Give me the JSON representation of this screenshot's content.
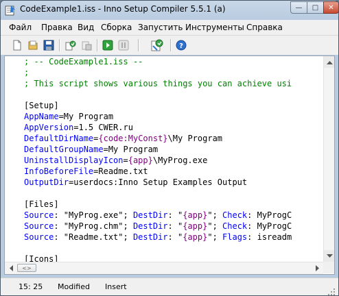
{
  "window": {
    "title": "CodeExample1.iss - Inno Setup Compiler 5.5.1 (a)",
    "controls": {
      "minimize": "—",
      "maximize": "□",
      "close": "✕"
    }
  },
  "menu": [
    "Файл",
    "Правка",
    "Вид",
    "Сборка",
    "Запустить",
    "Инструменты",
    "Справка"
  ],
  "toolbar": {
    "buttons": [
      "new-icon",
      "open-icon",
      "save-icon",
      "compile-icon",
      "stop-compile-icon",
      "run-icon",
      "pause-icon",
      "wizard-icon",
      "help-icon"
    ]
  },
  "editor": {
    "lines": [
      [
        {
          "t": "; -- CodeExample1.iss --",
          "c": "comment"
        }
      ],
      [
        {
          "t": ";",
          "c": "comment"
        }
      ],
      [
        {
          "t": "; This script shows various things you can achieve usi",
          "c": "comment"
        }
      ],
      [],
      [
        {
          "t": "[Setup]",
          "c": "section"
        }
      ],
      [
        {
          "t": "AppName",
          "c": "key"
        },
        {
          "t": "=My Program",
          "c": "val"
        }
      ],
      [
        {
          "t": "AppVersion",
          "c": "key"
        },
        {
          "t": "=1.5 CWER.ru",
          "c": "val"
        }
      ],
      [
        {
          "t": "DefaultDirName",
          "c": "key"
        },
        {
          "t": "=",
          "c": "val"
        },
        {
          "t": "{code:MyConst}",
          "c": "const"
        },
        {
          "t": "\\My Program",
          "c": "val"
        }
      ],
      [
        {
          "t": "DefaultGroupName",
          "c": "key"
        },
        {
          "t": "=My Program",
          "c": "val"
        }
      ],
      [
        {
          "t": "UninstallDisplayIcon",
          "c": "key"
        },
        {
          "t": "=",
          "c": "val"
        },
        {
          "t": "{app}",
          "c": "const"
        },
        {
          "t": "\\MyProg.exe",
          "c": "val"
        }
      ],
      [
        {
          "t": "InfoBeforeFile",
          "c": "key"
        },
        {
          "t": "=Readme.txt",
          "c": "val"
        }
      ],
      [
        {
          "t": "OutputDir",
          "c": "key"
        },
        {
          "t": "=userdocs:Inno Setup Examples Output",
          "c": "val"
        }
      ],
      [],
      [
        {
          "t": "[Files]",
          "c": "section"
        }
      ],
      [
        {
          "t": "Source",
          "c": "key"
        },
        {
          "t": ": \"MyProg.exe\"; ",
          "c": "val"
        },
        {
          "t": "DestDir",
          "c": "key"
        },
        {
          "t": ": \"",
          "c": "val"
        },
        {
          "t": "{app}",
          "c": "const"
        },
        {
          "t": "\"; ",
          "c": "val"
        },
        {
          "t": "Check",
          "c": "key"
        },
        {
          "t": ": MyProgC",
          "c": "val"
        }
      ],
      [
        {
          "t": "Source",
          "c": "key"
        },
        {
          "t": ": \"MyProg.chm\"; ",
          "c": "val"
        },
        {
          "t": "DestDir",
          "c": "key"
        },
        {
          "t": ": \"",
          "c": "val"
        },
        {
          "t": "{app}",
          "c": "const"
        },
        {
          "t": "\"; ",
          "c": "val"
        },
        {
          "t": "Check",
          "c": "key"
        },
        {
          "t": ": MyProgC",
          "c": "val"
        }
      ],
      [
        {
          "t": "Source",
          "c": "key"
        },
        {
          "t": ": \"Readme.txt\"; ",
          "c": "val"
        },
        {
          "t": "DestDir",
          "c": "key"
        },
        {
          "t": ": \"",
          "c": "val"
        },
        {
          "t": "{app}",
          "c": "const"
        },
        {
          "t": "\"; ",
          "c": "val"
        },
        {
          "t": "Flags",
          "c": "key"
        },
        {
          "t": ": isreadm",
          "c": "val"
        }
      ],
      [],
      [
        {
          "t": "[Icons]",
          "c": "section"
        }
      ]
    ],
    "hscroll_thumb": "<>"
  },
  "status": {
    "position": "15: 25",
    "modified": "Modified",
    "mode": "Insert"
  },
  "colors": {
    "comment": "#008000",
    "key": "#0000ff",
    "const": "#800080",
    "text": "#000000"
  }
}
